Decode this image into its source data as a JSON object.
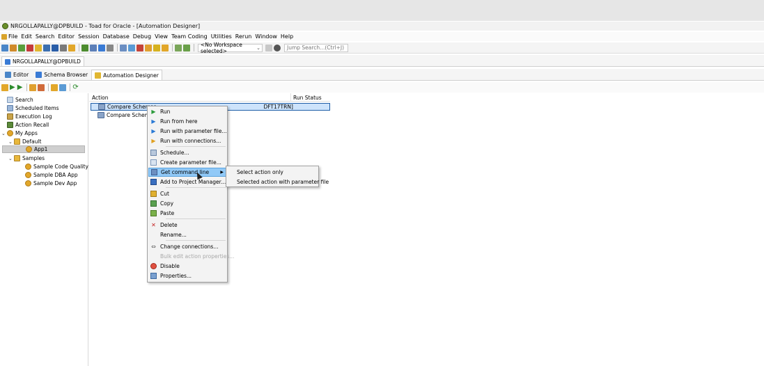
{
  "window": {
    "title": "NRGOLLAPALLY@DPBUILD - Toad for Oracle - [Automation Designer]"
  },
  "menu": [
    "File",
    "Edit",
    "Search",
    "Editor",
    "Session",
    "Database",
    "Debug",
    "View",
    "Team Coding",
    "Utilities",
    "Rerun",
    "Window",
    "Help"
  ],
  "toolbar": {
    "workspace_value": "<No Workspace selected>",
    "jump_search_placeholder": "Jump Search...(Ctrl+J)"
  },
  "connection_tab": "NRGOLLAPALLY@DPBUILD",
  "subtabs": [
    "Editor",
    "Schema Browser",
    "Automation Designer"
  ],
  "tree": [
    {
      "label": "Search",
      "indent": 0
    },
    {
      "label": "Scheduled Items",
      "indent": 0
    },
    {
      "label": "Execution Log",
      "indent": 0
    },
    {
      "label": "Action Recall",
      "indent": 0
    },
    {
      "label": "My Apps",
      "indent": 0
    },
    {
      "label": "Default",
      "indent": 1
    },
    {
      "label": "App1",
      "indent": 2
    },
    {
      "label": "Samples",
      "indent": 1
    },
    {
      "label": "Sample Code Quality ...",
      "indent": 2
    },
    {
      "label": "Sample DBA App",
      "indent": 2
    },
    {
      "label": "Sample Dev App",
      "indent": 2
    }
  ],
  "table": {
    "columns": [
      "Action",
      "Run Status"
    ],
    "rows": [
      {
        "action": "Compare Schemas",
        "extra": "DFT17TRN]"
      },
      {
        "action": "Compare Schemas",
        "extra": ""
      }
    ]
  },
  "context_menu": {
    "items": [
      "Run",
      "Run from here",
      "Run with parameter file...",
      "Run with connections...",
      "Schedule...",
      "Create parameter file...",
      "Get command line",
      "Add to Project Manager...",
      "Cut",
      "Copy",
      "Paste",
      "Delete",
      "Rename...",
      "Change connections...",
      "Bulk edit action properties...",
      "Disable",
      "Properties..."
    ],
    "highlighted": "Get command line",
    "disabled": "Bulk edit action properties..."
  },
  "submenu": {
    "items": [
      "Select action only",
      "Selected action with parameter file"
    ]
  },
  "colors": {
    "selection": "#cde3fb",
    "menu_highlight": "#91c9f7"
  }
}
